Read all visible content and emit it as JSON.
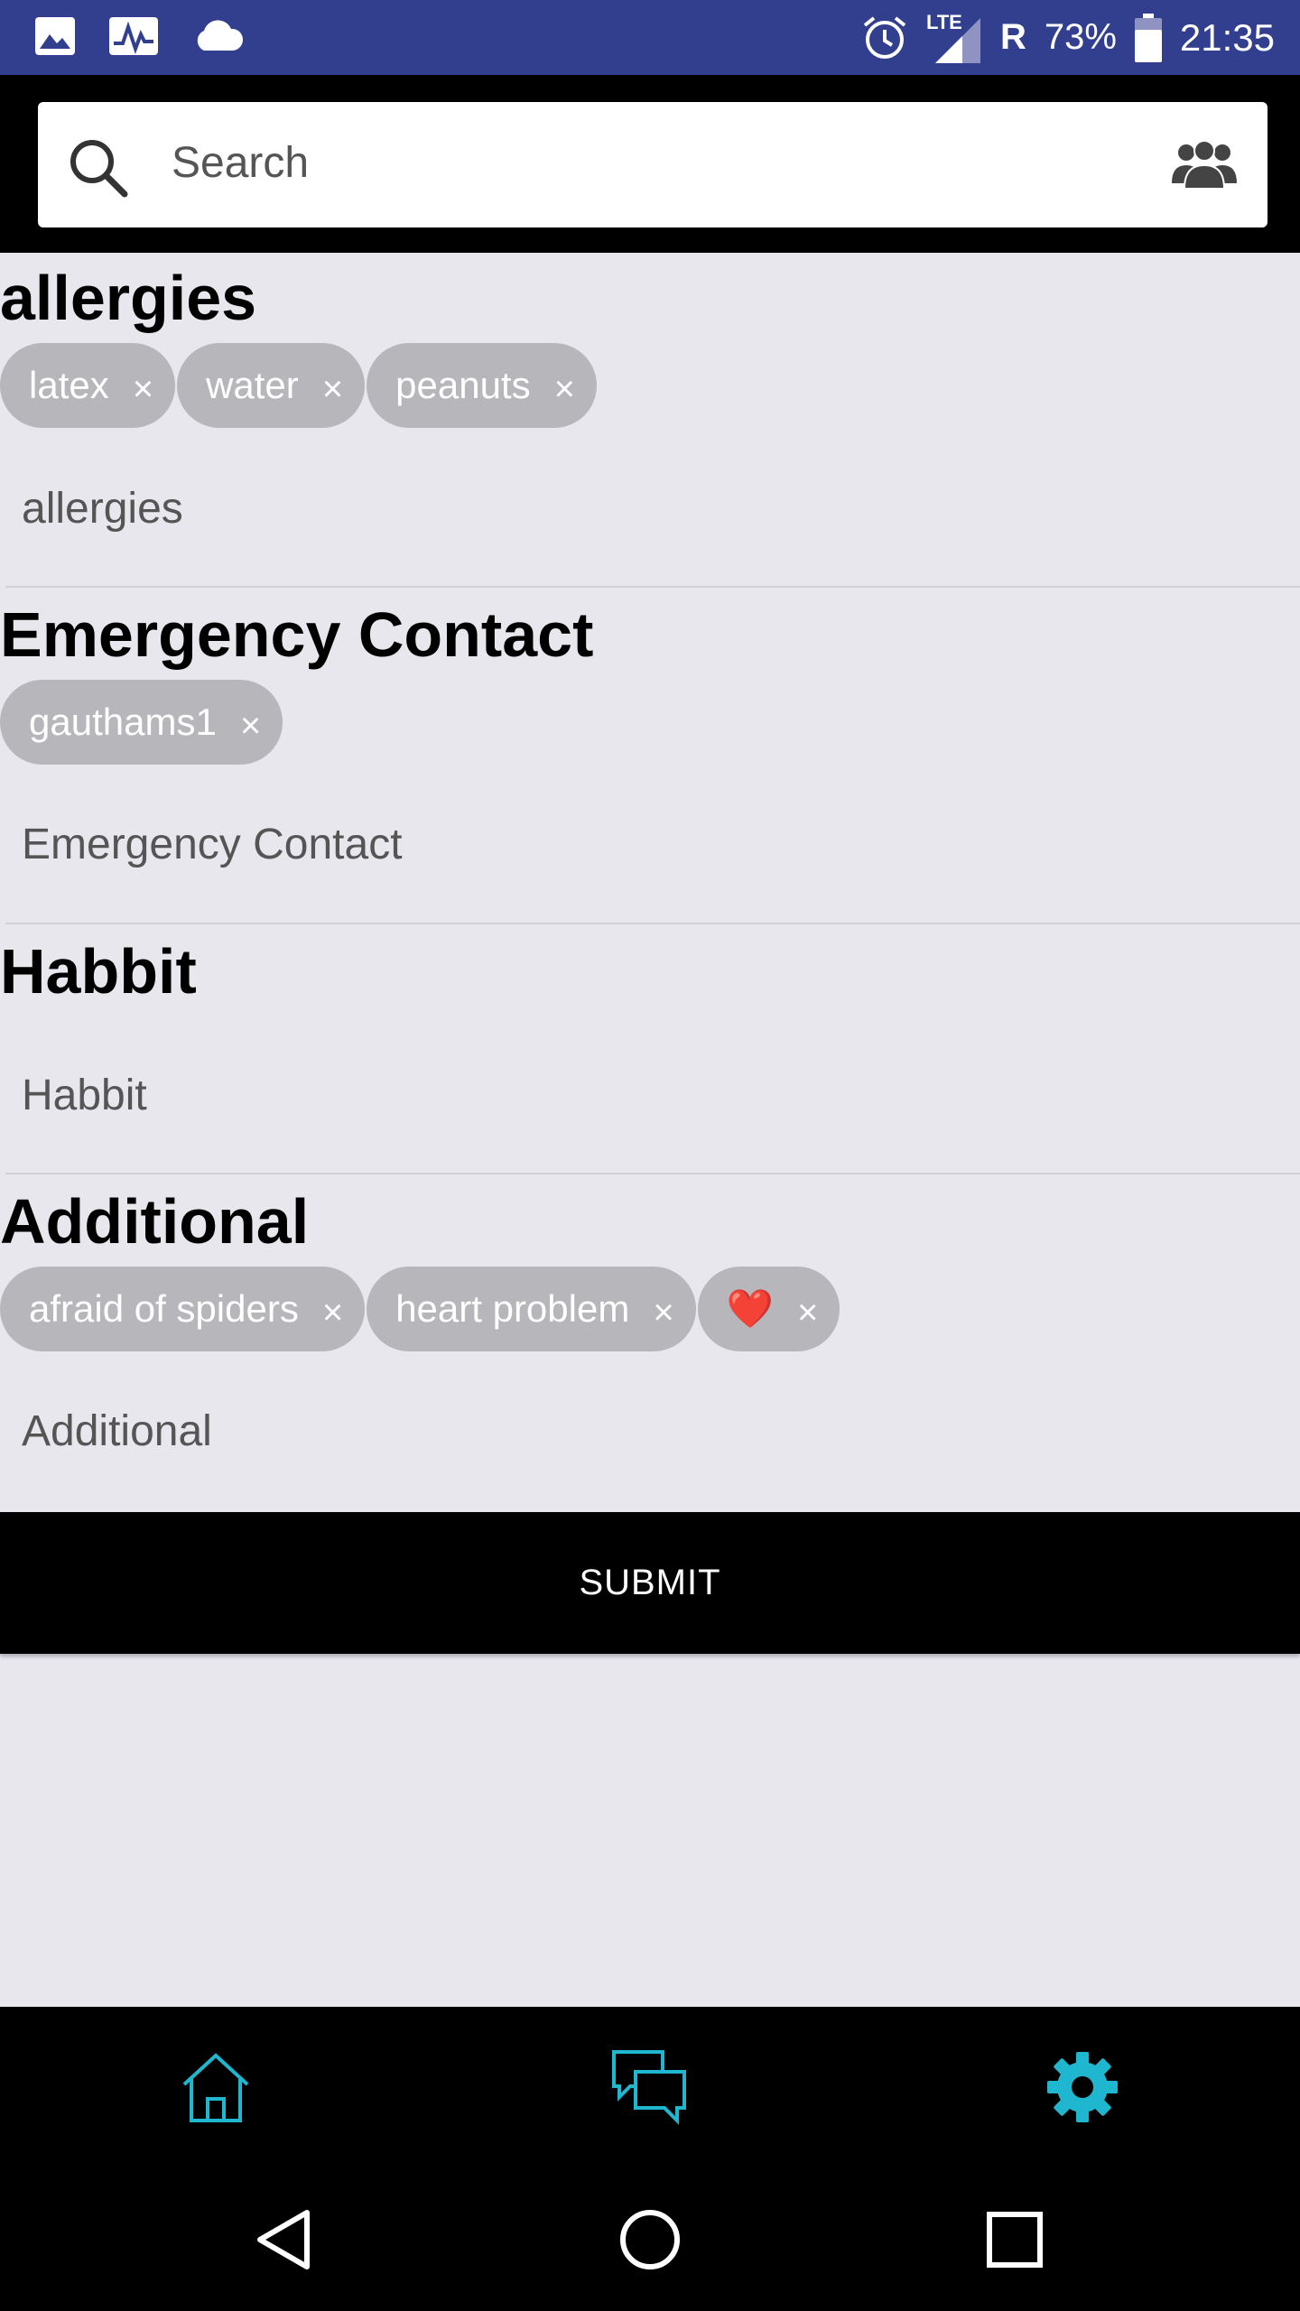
{
  "status_bar": {
    "network": "LTE",
    "roaming": "R",
    "battery": "73%",
    "time": "21:35"
  },
  "search": {
    "placeholder": "Search"
  },
  "sections": {
    "allergies": {
      "title": "allergies",
      "chips": [
        "latex",
        "water",
        "peanuts"
      ],
      "input_placeholder": "allergies"
    },
    "emergency": {
      "title": "Emergency Contact",
      "chips": [
        "gauthams1"
      ],
      "input_placeholder": "Emergency Contact"
    },
    "habbit": {
      "title": "Habbit",
      "input_placeholder": "Habbit"
    },
    "additional": {
      "title": "Additional",
      "chips": [
        "afraid of spiders",
        "heart problem",
        "❤️"
      ],
      "input_placeholder": "Additional"
    }
  },
  "chip_remove_glyph": "×",
  "submit_label": "SUBMIT",
  "colors": {
    "status_bar": "#323f8e",
    "accent": "#1fb7cf",
    "chip": "#b7b6bb",
    "background": "#e8e7ee"
  },
  "icons": {
    "search": "search-icon",
    "contacts": "group-icon",
    "home": "home-icon",
    "chat": "chat-icon",
    "settings": "gear-icon"
  }
}
